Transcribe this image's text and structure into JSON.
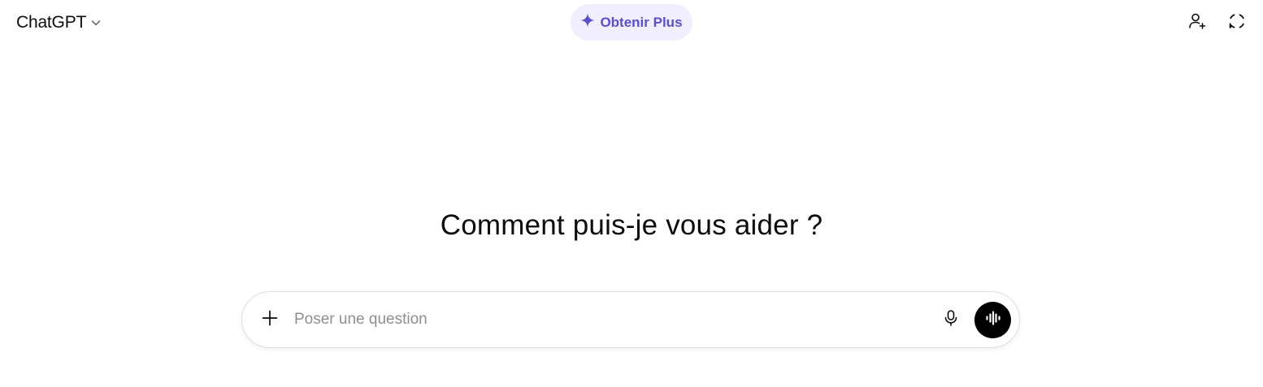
{
  "header": {
    "model_name": "ChatGPT",
    "model_menu_icon": "chevron-down-icon",
    "upgrade_label": "Obtenir Plus",
    "upgrade_icon": "sparkle-icon",
    "right_icons": [
      "add-person-icon",
      "temporary-chat-icon"
    ]
  },
  "main": {
    "headline": "Comment puis-je vous aider ?"
  },
  "composer": {
    "placeholder": "Poser une question",
    "value": "",
    "add_icon": "plus-icon",
    "mic_icon": "microphone-icon",
    "voice_icon": "voice-mode-icon"
  },
  "colors": {
    "accent": "#5a4fcf",
    "upgrade_bg": "#f1efff",
    "text": "#0d0d0d",
    "placeholder": "#8f8f8f",
    "voice_button": "#000000"
  }
}
